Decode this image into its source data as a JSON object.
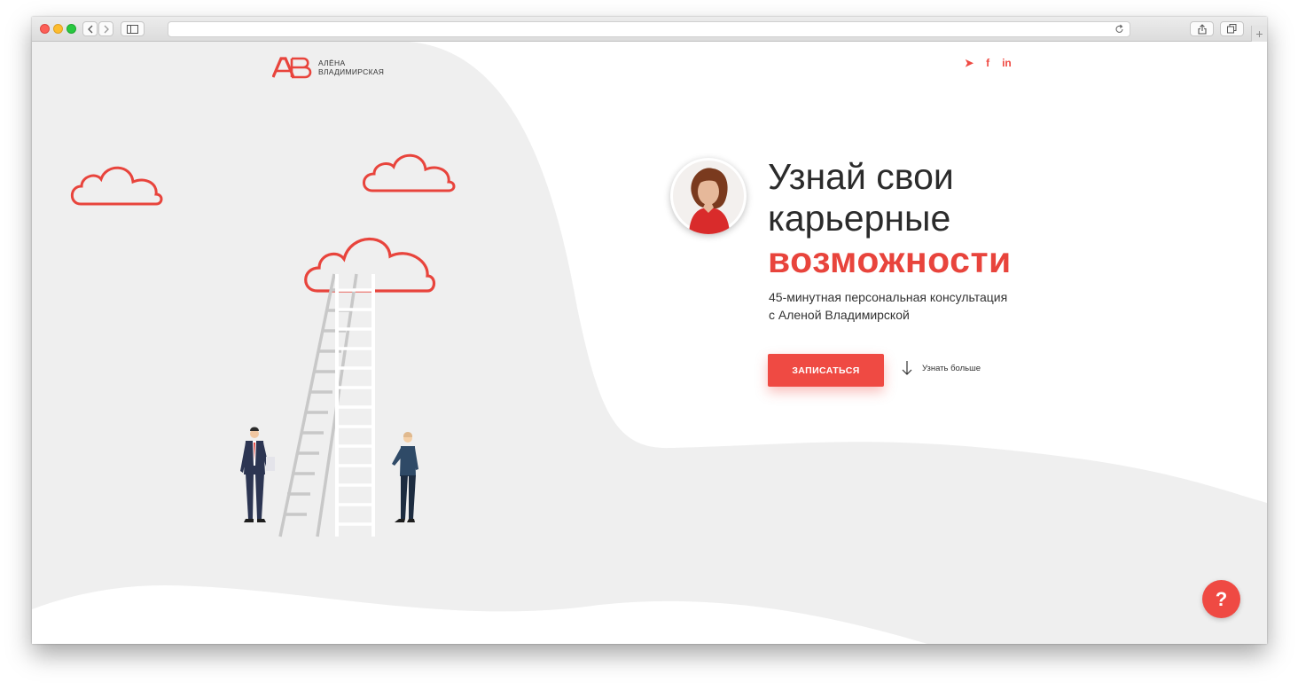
{
  "browser": {
    "icons": {
      "back": "chevron-left-icon",
      "forward": "chevron-right-icon",
      "sidebar": "sidebar-icon",
      "reload": "reload-icon",
      "share": "share-icon",
      "tabs": "tabs-icon"
    },
    "new_tab": "+"
  },
  "logo": {
    "mark": "АВ",
    "line1": "АЛЁНА",
    "line2": "ВЛАДИМИРСКАЯ"
  },
  "social": {
    "telegram": "➤",
    "facebook": "f",
    "linkedin": "in"
  },
  "hero": {
    "title_line1": "Узнай свои",
    "title_line2": "карьерные",
    "title_accent": "возможности",
    "subtitle_line1": "45-минутная персональная консультация",
    "subtitle_line2": "с Аленой Владимирской",
    "cta_label": "ЗАПИСАТЬСЯ",
    "more_label": "Узнать больше"
  },
  "help": {
    "label": "?"
  },
  "colors": {
    "accent": "#ef4a43",
    "text": "#2b2b2b",
    "background_shape": "#efefef"
  }
}
